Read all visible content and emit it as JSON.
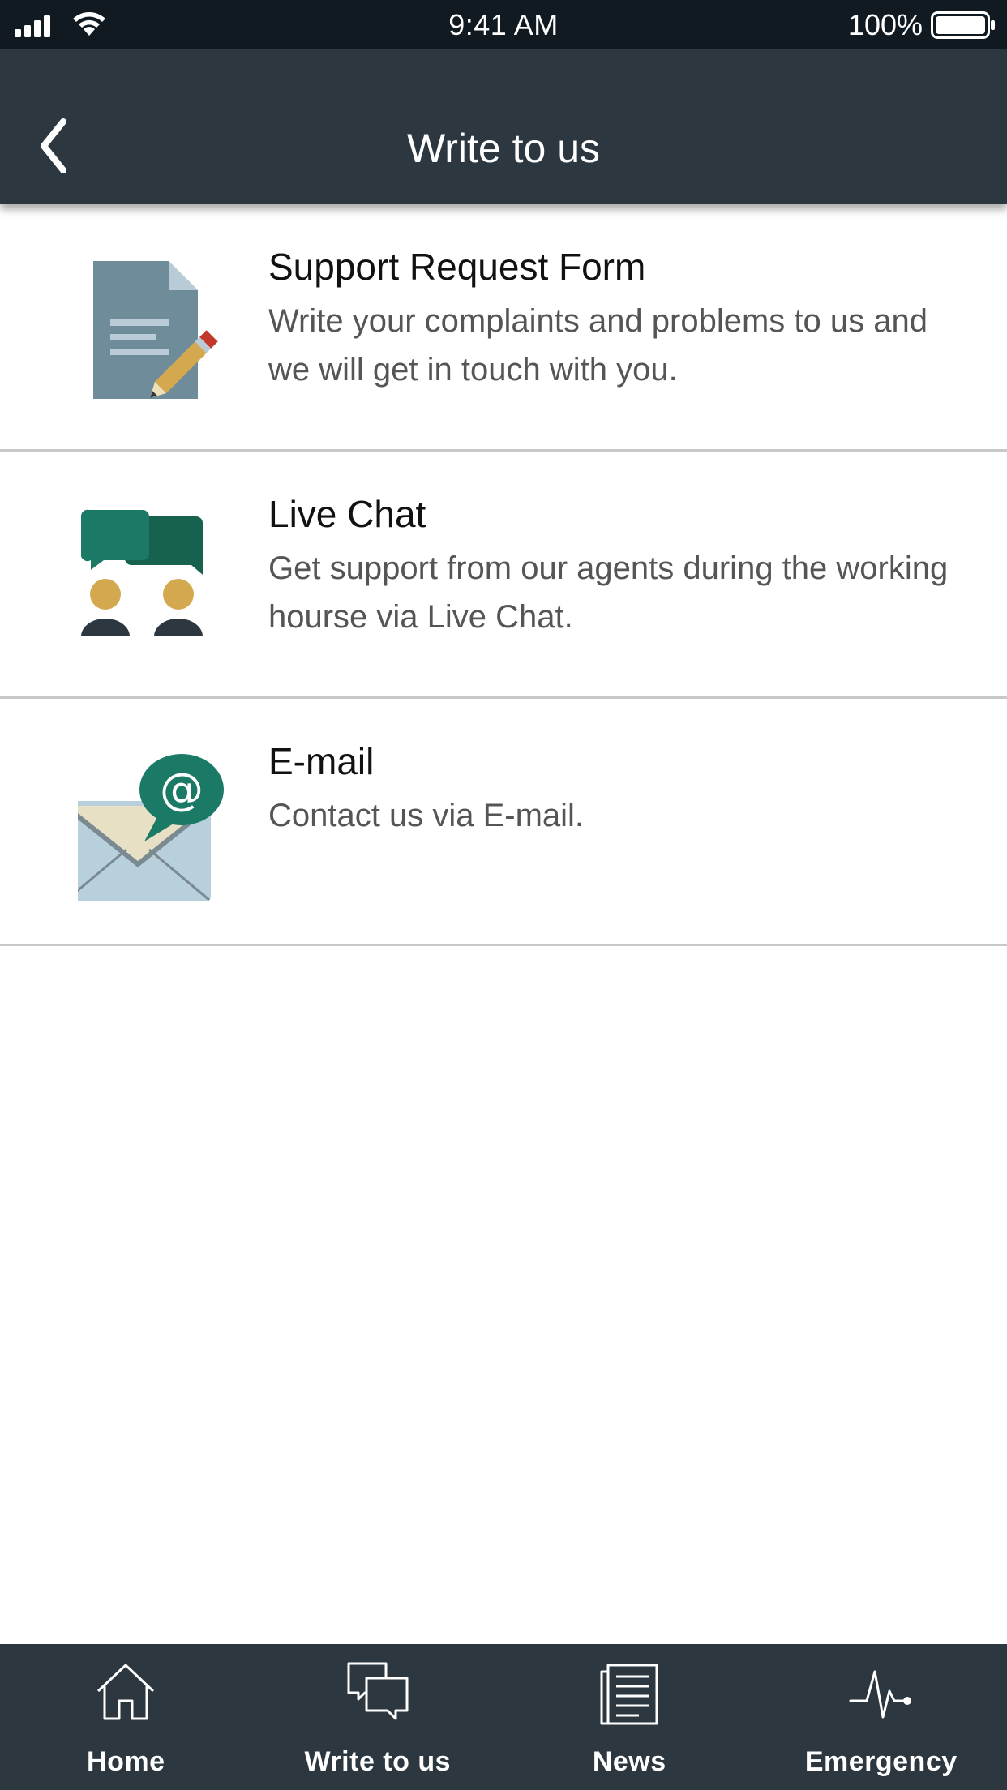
{
  "status_bar": {
    "time": "9:41 AM",
    "battery": "100%",
    "icons": [
      "signal-icon",
      "wifi-icon",
      "battery-icon"
    ]
  },
  "header": {
    "title": "Write to us",
    "back_icon": "chevron-left-icon"
  },
  "options": [
    {
      "title": "Support Request Form",
      "description": "Write your complaints and problems to us and we will get in touch with you.",
      "icon": "document-pencil-icon"
    },
    {
      "title": "Live Chat",
      "description": "Get support from our agents during the working hourse via Live Chat.",
      "icon": "chat-agents-icon"
    },
    {
      "title": "E-mail",
      "description": "Contact us via E-mail.",
      "icon": "envelope-at-icon"
    }
  ],
  "tab_bar": {
    "tabs": [
      {
        "label": "Home",
        "icon": "home-icon"
      },
      {
        "label": "Write to us",
        "icon": "chat-bubbles-icon"
      },
      {
        "label": "News",
        "icon": "newspaper-icon"
      },
      {
        "label": "Emergency",
        "icon": "heartbeat-icon"
      }
    ]
  },
  "colors": {
    "status_bar_bg": "#121a21",
    "header_bg": "#2c3740",
    "divider": "#c8c8c8",
    "teal": "#1a7a66",
    "gold": "#d4a84f"
  }
}
